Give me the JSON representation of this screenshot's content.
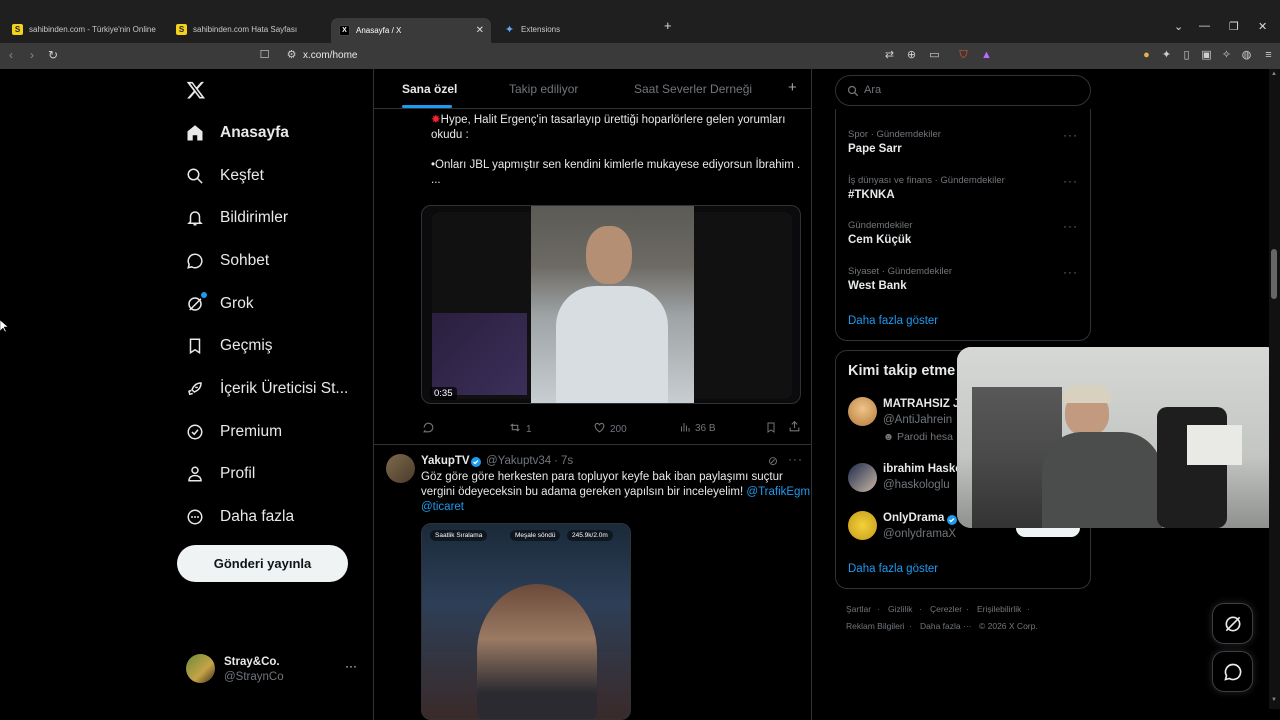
{
  "browser": {
    "tabs": [
      {
        "label": "sahibinden.com - Türkiye'nin Online",
        "icon": "S"
      },
      {
        "label": "sahibinden.com Hata Sayfası",
        "icon": "S"
      },
      {
        "label": "Anasayfa / X",
        "icon": "X"
      },
      {
        "label": "Extensions",
        "icon": "puzzle"
      }
    ],
    "new_tab": "+",
    "url": "x.com/home"
  },
  "nav": {
    "items": [
      {
        "label": "Anasayfa",
        "icon": "home-icon"
      },
      {
        "label": "Keşfet",
        "icon": "search-icon"
      },
      {
        "label": "Bildirimler",
        "icon": "bell-icon"
      },
      {
        "label": "Sohbet",
        "icon": "chat-icon"
      },
      {
        "label": "Grok",
        "icon": "grok-icon"
      },
      {
        "label": "Geçmiş",
        "icon": "bookmark-icon"
      },
      {
        "label": "İçerik Üreticisi St...",
        "icon": "rocket-icon"
      },
      {
        "label": "Premium",
        "icon": "verified-icon"
      },
      {
        "label": "Profil",
        "icon": "person-icon"
      },
      {
        "label": "Daha fazla",
        "icon": "more-circle-icon"
      }
    ],
    "post_button": "Gönderi yayınla",
    "account": {
      "name": "Stray&Co.",
      "handle": "@StraynCo",
      "more": "···"
    }
  },
  "feed": {
    "tabs": [
      "Sana özel",
      "Takip ediliyor",
      "Saat Severler Derneği"
    ],
    "add_tab": "+",
    "tweet1": {
      "text_line1": "Hype, Halit Ergenç'in tasarlayıp ürettiği hoparlörlere gelen yorumları",
      "text_line2": "okudu :",
      "text_line3": "•Onları JBL yapmıştır sen kendini kimlerle mukayese ediyorsun İbrahim .",
      "text_line4": "...",
      "video_time": "0:35",
      "retweets": "1",
      "likes": "200",
      "views": "36 B"
    },
    "tweet2": {
      "name": "YakupTV",
      "handle": "@Yakuptv34",
      "time": "· 7s",
      "text_line1": "Göz göre göre herkesten para topluyor keyfe bak iban paylaşımı suçtur",
      "text_line2": "vergini ödeyeceksin bu adama gereken yapılsın bir inceleyelim!",
      "mention1": "@TrafikEgm",
      "mention2": "@ticaret",
      "overlay_badge1": "Saatlik Sıralama",
      "overlay_badge2": "Meşale söndü",
      "overlay_badge3": "245.9k/2.0m"
    }
  },
  "sidebar": {
    "search_placeholder": "Ara",
    "trends": [
      {
        "category": "Spor · Gündemdekiler",
        "name": "Pape Sarr"
      },
      {
        "category": "İş dünyası ve finans · Gündemdekiler",
        "name": "#TKNKA"
      },
      {
        "category": "Gündemdekiler",
        "name": "Cem Küçük"
      },
      {
        "category": "Siyaset · Gündemdekiler",
        "name": "West Bank"
      }
    ],
    "trend_more": "···",
    "show_more": "Daha fazla göster",
    "who_to_follow_title": "Kimi takip etme",
    "follow": [
      {
        "name": "MATRAHSIZ Ja",
        "handle": "@AntiJahrein",
        "note": "Parodi hesa"
      },
      {
        "name": "ibrahim Hasko",
        "handle": "@haskologlu"
      },
      {
        "name": "OnlyDrama",
        "handle": "@onlydramaX"
      }
    ],
    "follow_show_more": "Daha fazla göster",
    "footer": [
      "Şartlar",
      "·",
      "Gizlilik",
      "·",
      "Çerezler",
      "·",
      "Erişilebilirlik",
      "·",
      "Reklam Bilgileri",
      "·",
      "Daha fazla ···",
      "© 2026 X Corp."
    ]
  },
  "colors": {
    "accent": "#1d9bf0",
    "background": "#000000",
    "text": "#e7e9ea",
    "muted": "#71767b",
    "border": "#2f3336"
  }
}
